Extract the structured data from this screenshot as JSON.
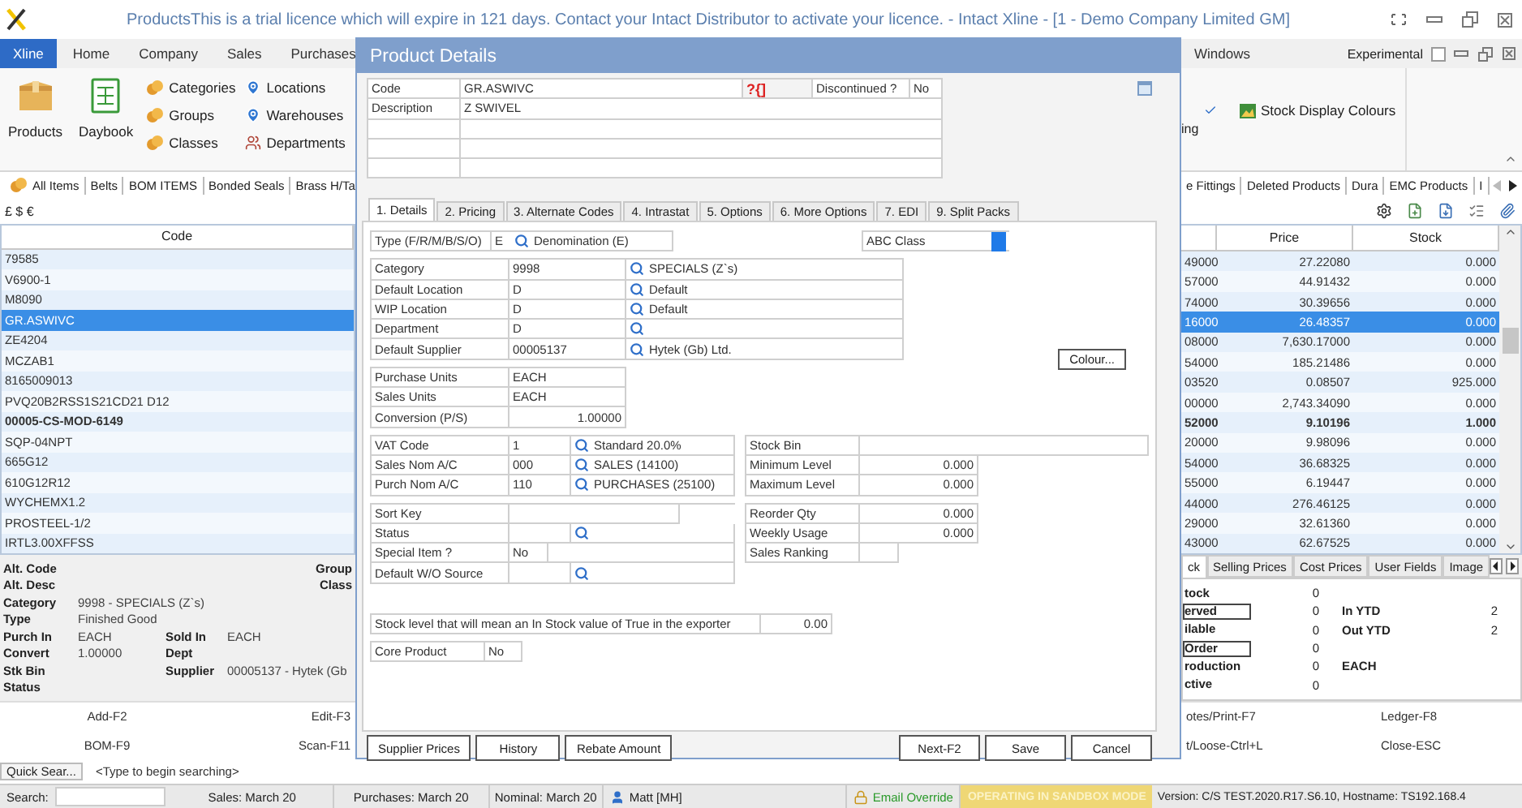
{
  "app_title": "ProductsThis is a trial licence which will expire in 121 days. Contact your Intact Distributor to activate your licence. - Intact Xline - [1 - Demo Company Limited GM]",
  "ribbon_tabs": [
    {
      "label": "Xline",
      "selected": true
    },
    {
      "label": "Home",
      "selected": false
    },
    {
      "label": "Company",
      "selected": false
    },
    {
      "label": "Sales",
      "selected": false
    },
    {
      "label": "Purchases",
      "selected": false
    }
  ],
  "ribbon_tabs_right": [
    "Windows"
  ],
  "experimental": {
    "label": "Experimental",
    "checked": false
  },
  "ribbon_large": [
    {
      "label": "Products",
      "kind": "box"
    },
    {
      "label": "Daybook",
      "kind": "book"
    }
  ],
  "ribbon_small": [
    {
      "label": "Categories",
      "kind": "coins"
    },
    {
      "label": "Groups",
      "kind": "coins"
    },
    {
      "label": "Classes",
      "kind": "coins"
    },
    {
      "label": "Locations",
      "kind": "pin"
    },
    {
      "label": "Warehouses",
      "kind": "pin"
    },
    {
      "label": "Departments",
      "kind": "people"
    }
  ],
  "ribbon_right": {
    "partial": "ing",
    "button": "Stock Display Colours"
  },
  "filter_tabs_left": [
    "All Items",
    "Belts",
    "BOM ITEMS",
    "Bonded Seals",
    "Brass H/Ta"
  ],
  "filter_tabs_right": [
    "e Fittings",
    "Deleted Products",
    "Dura",
    "EMC Products",
    "I"
  ],
  "currency": "£ $ €",
  "table": {
    "columns": [
      "Code",
      "Price",
      "Stock"
    ],
    "rows": [
      {
        "code": "79585",
        "column_2": "49000",
        "price": "27.22080",
        "stock": "0.000",
        "selected": false,
        "bold": false
      },
      {
        "code": "V6900-1",
        "column_2": "57000",
        "price": "44.91432",
        "stock": "0.000",
        "selected": false,
        "bold": false
      },
      {
        "code": "M8090",
        "column_2": "74000",
        "price": "30.39656",
        "stock": "0.000",
        "selected": false,
        "bold": false
      },
      {
        "code": "GR.ASWIVC",
        "column_2": "16000",
        "price": "26.48357",
        "stock": "0.000",
        "selected": true,
        "bold": false
      },
      {
        "code": "ZE4204",
        "column_2": "08000",
        "price": "7,630.17000",
        "stock": "0.000",
        "selected": false,
        "bold": false
      },
      {
        "code": "MCZAB1",
        "column_2": "54000",
        "price": "185.21486",
        "stock": "0.000",
        "selected": false,
        "bold": false
      },
      {
        "code": "8165009013",
        "column_2": "03520",
        "price": "0.08507",
        "stock": "925.000",
        "selected": false,
        "bold": false
      },
      {
        "code": "PVQ20B2RSS1S21CD21 D12",
        "column_2": "00000",
        "price": "2,743.34090",
        "stock": "0.000",
        "selected": false,
        "bold": false
      },
      {
        "code": "00005-CS-MOD-6149",
        "column_2": "52000",
        "price": "9.10196",
        "stock": "1.000",
        "selected": false,
        "bold": true
      },
      {
        "code": "SQP-04NPT",
        "column_2": "20000",
        "price": "9.98096",
        "stock": "0.000",
        "selected": false,
        "bold": false
      },
      {
        "code": "665G12",
        "column_2": "54000",
        "price": "36.68325",
        "stock": "0.000",
        "selected": false,
        "bold": false
      },
      {
        "code": "610G12R12",
        "column_2": "55000",
        "price": "6.19447",
        "stock": "0.000",
        "selected": false,
        "bold": false
      },
      {
        "code": "WYCHEMX1.2",
        "column_2": "44000",
        "price": "276.46125",
        "stock": "0.000",
        "selected": false,
        "bold": false
      },
      {
        "code": "PROSTEEL-1/2",
        "column_2": "29000",
        "price": "32.61360",
        "stock": "0.000",
        "selected": false,
        "bold": false
      },
      {
        "code": "IRTL3.00XFFSS",
        "column_2": "43000",
        "price": "62.67525",
        "stock": "0.000",
        "selected": false,
        "bold": false
      }
    ]
  },
  "summary": [
    {
      "label": "Alt. Code",
      "right_label": "Group"
    },
    {
      "label": "Alt. Desc",
      "right_label": "Class"
    },
    {
      "label": "Category",
      "value": "9998 - SPECIALS (Z`s)"
    },
    {
      "label": "Type",
      "value": "Finished Good"
    },
    {
      "label": "Purch In",
      "value": "EACH",
      "label_2": "Sold In",
      "value_2": "EACH"
    },
    {
      "label": "Convert",
      "value": "1.00000",
      "label_2": "Dept"
    },
    {
      "label": "Stk Bin",
      "label_2": "Supplier",
      "value_2": "00005137 - Hytek (Gb"
    },
    {
      "label": "Status"
    }
  ],
  "stock_tabs": [
    {
      "label": "ck",
      "selected": true
    },
    {
      "label": "Selling Prices",
      "selected": false
    },
    {
      "label": "Cost Prices",
      "selected": false
    },
    {
      "label": "User Fields",
      "selected": false
    },
    {
      "label": "Image",
      "selected": false
    }
  ],
  "stock_rows": [
    {
      "label": "tock",
      "value": "0",
      "boxed": false
    },
    {
      "label": "erved",
      "value": "0",
      "boxed": true
    },
    {
      "label": "ilable",
      "value": "0",
      "boxed": false
    },
    {
      "label": "Order",
      "value": "0",
      "boxed": true
    },
    {
      "label": "roduction",
      "value": "0",
      "boxed": false
    },
    {
      "label": "ctive",
      "value": "0",
      "boxed": false
    }
  ],
  "stock_totals": [
    {
      "label": "In YTD",
      "value": "2"
    },
    {
      "label": "Out YTD",
      "value": "2"
    }
  ],
  "stock_unit": "EACH",
  "actions_left": [
    "Add-F2",
    "Edit-F3",
    "BOM-F9",
    "Scan-F11"
  ],
  "actions_right": [
    "otes/Print-F7",
    "Ledger-F8",
    "t/Loose-Ctrl+L",
    "Close-ESC"
  ],
  "quick_search": {
    "label": "Quick Sear...",
    "placeholder": "<Type to begin searching>"
  },
  "status_bar": {
    "search_label": "Search:",
    "items": [
      {
        "kind": "text",
        "text": "Sales: March 20"
      },
      {
        "kind": "text",
        "text": "Purchases: March 20"
      },
      {
        "kind": "text",
        "text": "Nominal: March 20"
      },
      {
        "kind": "user",
        "text": "Matt [MH]"
      },
      {
        "kind": "email",
        "text": "Email Override"
      },
      {
        "kind": "sandbox",
        "text": "OPERATING IN SANDBOX MODE"
      },
      {
        "kind": "version",
        "text": "Version: C/S TEST.2020.R17.S6.10, Hostname: TS192.168.4"
      }
    ]
  },
  "dialog": {
    "title": "Product Details",
    "header": [
      {
        "label": "Code",
        "value": "GR.ASWIVC"
      },
      {
        "label": "Description",
        "value": "Z SWIVEL"
      }
    ],
    "help_glyph": "?{]",
    "discontinued": {
      "label": "Discontinued ?",
      "value": "No"
    },
    "tabs": [
      {
        "label": "1. Details",
        "selected": true
      },
      {
        "label": "2. Pricing",
        "selected": false
      },
      {
        "label": "3. Alternate Codes",
        "selected": false
      },
      {
        "label": "4. Intrastat",
        "selected": false
      },
      {
        "label": "5. Options",
        "selected": false
      },
      {
        "label": "6. More Options",
        "selected": false
      },
      {
        "label": "7. EDI",
        "selected": false
      },
      {
        "label": "9. Split Packs",
        "selected": false
      }
    ],
    "type_row": {
      "label": "Type (F/R/M/B/S/O)",
      "value": "E",
      "name": "Denomination (E)"
    },
    "abc_class": "ABC Class",
    "lookup_rows": [
      {
        "label": "Category",
        "code": "9998",
        "name": "SPECIALS (Z`s)"
      },
      {
        "label": "Default Location",
        "code": "D",
        "name": "Default"
      },
      {
        "label": "WIP Location",
        "code": "D",
        "name": "Default"
      },
      {
        "label": "Department",
        "code": "D"
      },
      {
        "label": "Default Supplier",
        "code": "00005137",
        "name": "Hytek (Gb) Ltd."
      }
    ],
    "colour_button": "Colour...",
    "unit_rows": [
      {
        "label": "Purchase Units",
        "value": "EACH",
        "kind": "text"
      },
      {
        "label": "Sales Units",
        "value": "EACH",
        "kind": "text"
      },
      {
        "label": "Conversion (P/S)",
        "value": "1.00000",
        "kind": "number"
      }
    ],
    "nominal_rows": [
      {
        "label": "VAT Code",
        "code": "1",
        "name": "Standard 20.0%"
      },
      {
        "label": "Sales Nom A/C",
        "code": "000",
        "name": "SALES (14100)"
      },
      {
        "label": "Purch Nom A/C",
        "code": "110",
        "name": "PURCHASES (25100)"
      }
    ],
    "level_rows": [
      {
        "label": "Stock Bin",
        "kind": "wide"
      },
      {
        "label": "Minimum Level",
        "value": "0.000",
        "kind": "number"
      },
      {
        "label": "Maximum Level",
        "value": "0.000",
        "kind": "number"
      }
    ],
    "misc_rows": [
      {
        "label": "Sort Key",
        "kind": "text"
      },
      {
        "label": "Status",
        "kind": "lookup"
      },
      {
        "label": "Special Item ?",
        "value": "No",
        "kind": "flag"
      },
      {
        "label": "Default W/O Source",
        "kind": "lookup"
      }
    ],
    "reorder_rows": [
      {
        "label": "Reorder Qty",
        "value": "0.000",
        "kind": "number"
      },
      {
        "label": "Weekly Usage",
        "value": "0.000",
        "kind": "number"
      },
      {
        "label": "Sales Ranking",
        "kind": "short"
      }
    ],
    "exporter_row": {
      "label": "Stock level that will mean an In Stock value of True in the exporter",
      "value": "0.00"
    },
    "core_product": {
      "label": "Core Product",
      "value": "No"
    },
    "buttons_left": [
      "Supplier Prices",
      "History",
      "Rebate Amount"
    ],
    "buttons_right": [
      "Next-F2",
      "Save",
      "Cancel"
    ]
  }
}
